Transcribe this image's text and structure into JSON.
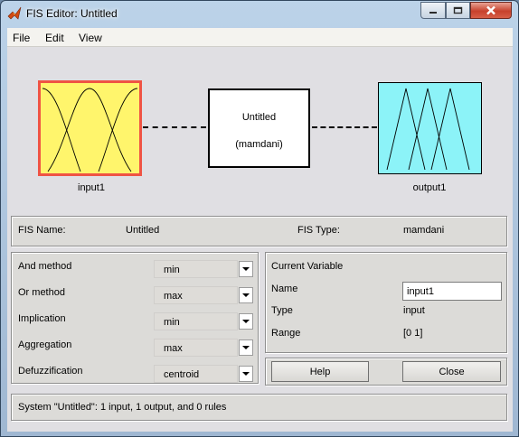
{
  "window": {
    "title": "FIS Editor: Untitled"
  },
  "menu": {
    "items": [
      "File",
      "Edit",
      "View"
    ]
  },
  "diagram": {
    "input_label": "input1",
    "output_label": "output1",
    "system_name": "Untitled",
    "system_type": "(mamdani)",
    "input_color": "#fff56c",
    "input_border": "#ef5344",
    "output_color": "#8cf3f8"
  },
  "fis_info": {
    "name_label": "FIS Name:",
    "name_value": "Untitled",
    "type_label": "FIS Type:",
    "type_value": "mamdani"
  },
  "methods": [
    {
      "label": "And method",
      "value": "min"
    },
    {
      "label": "Or method",
      "value": "max"
    },
    {
      "label": "Implication",
      "value": "min"
    },
    {
      "label": "Aggregation",
      "value": "max"
    },
    {
      "label": "Defuzzification",
      "value": "centroid"
    }
  ],
  "current_variable": {
    "header": "Current Variable",
    "name_label": "Name",
    "name_value": "input1",
    "type_label": "Type",
    "type_value": "input",
    "range_label": "Range",
    "range_value": "[0 1]"
  },
  "buttons": {
    "help": "Help",
    "close": "Close"
  },
  "status": {
    "text": "System \"Untitled\": 1 input, 1 output, and 0 rules"
  },
  "icons": [
    "matlab-logo-icon",
    "minimize-icon",
    "maximize-icon",
    "close-icon",
    "chevron-down-icon"
  ]
}
